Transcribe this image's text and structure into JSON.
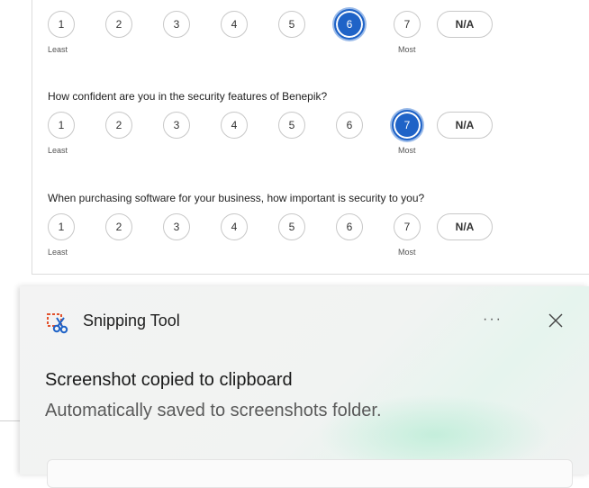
{
  "survey": {
    "scale": [
      "1",
      "2",
      "3",
      "4",
      "5",
      "6",
      "7"
    ],
    "na_label": "N/A",
    "least_label": "Least",
    "most_label": "Most",
    "questions": [
      {
        "text": "",
        "selected": "6"
      },
      {
        "text": "How confident are you in the security features of Benepik?",
        "selected": "7"
      },
      {
        "text": "When purchasing software for your business, how important is security to you?",
        "selected": null
      }
    ]
  },
  "toast": {
    "app_name": "Snipping Tool",
    "more_label": "···",
    "title": "Screenshot copied to clipboard",
    "subtitle": "Automatically saved to screenshots folder."
  },
  "colors": {
    "selected": "#1f63c7",
    "toast_glow": "#b9ecd5"
  }
}
